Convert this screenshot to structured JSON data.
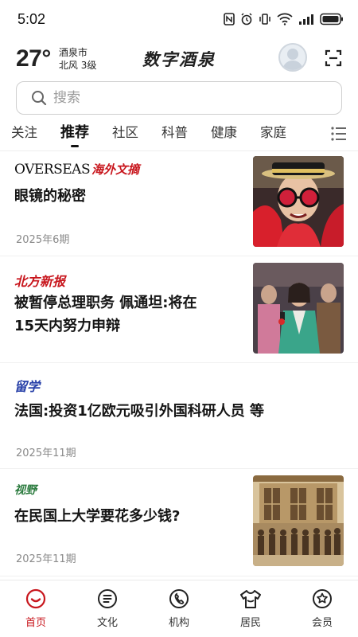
{
  "status_bar": {
    "time": "5:02"
  },
  "header": {
    "temperature": "27°",
    "city": "酒泉市",
    "wind": "北风  3级",
    "brand": "数字酒泉"
  },
  "search": {
    "placeholder": "搜索"
  },
  "tabs": [
    {
      "label": "关注",
      "active": false
    },
    {
      "label": "推荐",
      "active": true
    },
    {
      "label": "社区",
      "active": false
    },
    {
      "label": "科普",
      "active": false
    },
    {
      "label": "健康",
      "active": false
    },
    {
      "label": "家庭",
      "active": false
    }
  ],
  "articles": [
    {
      "source_en": "OVERSEAS",
      "source_cn": "海外文摘",
      "title": "眼镜的秘密",
      "meta": "2025年6期"
    },
    {
      "source": "北方新报",
      "source_color": "#c8161d",
      "title_line1": "被暂停总理职务  佩通坦:将在",
      "title_line2": "15天内努力申辩"
    },
    {
      "source": "留学",
      "source_color": "#2740a8",
      "title": "法国:投资1亿欧元吸引外国科研人员 等",
      "meta": "2025年11期"
    },
    {
      "source": "视野",
      "source_color": "#2a7a3d",
      "title": "在民国上大学要花多少钱?",
      "meta": "2025年11期"
    }
  ],
  "bottom_nav": [
    {
      "label": "首页",
      "icon": "home-icon",
      "active": true
    },
    {
      "label": "文化",
      "icon": "document-icon",
      "active": false
    },
    {
      "label": "机构",
      "icon": "phone-icon",
      "active": false
    },
    {
      "label": "居民",
      "icon": "shirt-icon",
      "active": false
    },
    {
      "label": "会员",
      "icon": "badge-icon",
      "active": false
    }
  ],
  "colors": {
    "accent": "#c8161d"
  }
}
